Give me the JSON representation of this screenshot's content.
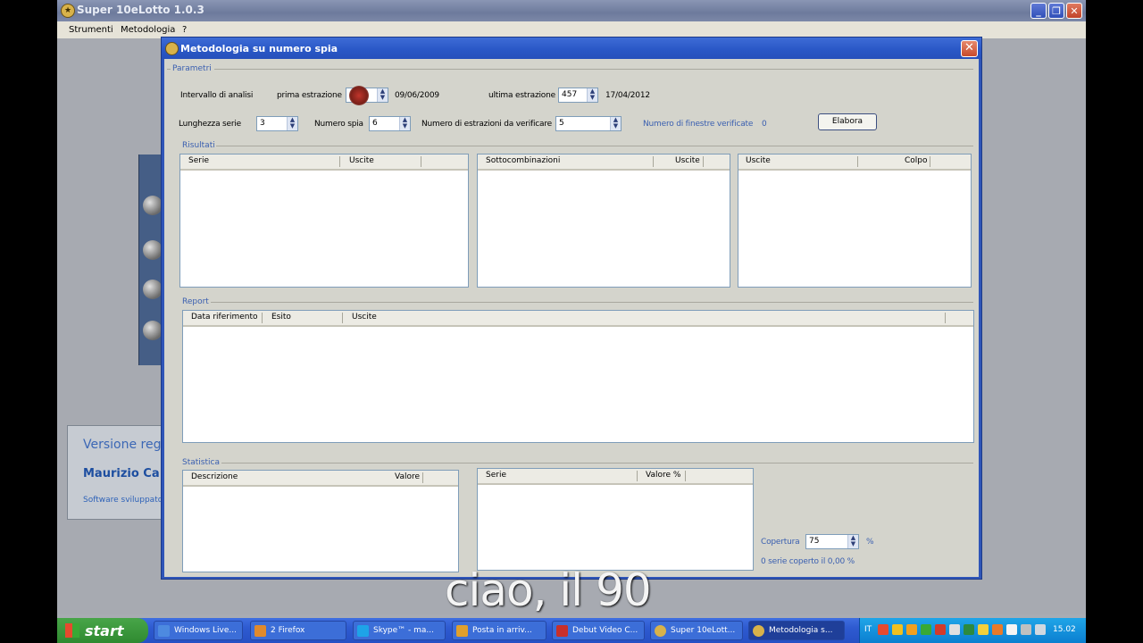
{
  "app": {
    "title": "Super 10eLotto 1.0.3",
    "menu": [
      "Strumenti",
      "Metodologia",
      "?"
    ],
    "license": {
      "version_text": "Versione regi",
      "name": "Maurizio Ca",
      "software_text": "Software sviluppato"
    }
  },
  "dialog": {
    "title": "Metodologia su numero spia",
    "close_label": "✕",
    "params": {
      "group_label": "Parametri",
      "interval_label": "Intervallo di analisi",
      "first_label": "prima estrazione",
      "first_value": "",
      "first_date": "09/06/2009",
      "last_label": "ultima estrazione",
      "last_value": "457",
      "last_date": "17/04/2012",
      "length_label": "Lunghezza serie",
      "length_value": "3",
      "spy_label": "Numero spia",
      "spy_value": "6",
      "draws_label": "Numero di estrazioni da verificare",
      "draws_value": "5",
      "windows_label": "Numero di finestre verificate",
      "windows_value": "0",
      "process_button": "Elabora"
    },
    "results": {
      "group_label": "Risultati",
      "list1": [
        "Serie",
        "Uscite"
      ],
      "list2": [
        "Sottocombinazioni",
        "Uscite"
      ],
      "list3": [
        "Uscite",
        "Colpo"
      ]
    },
    "report": {
      "group_label": "Report",
      "columns": [
        "Data riferimento",
        "Esito",
        "Uscite"
      ]
    },
    "stats": {
      "group_label": "Statistica",
      "list1": [
        "Descrizione",
        "Valore"
      ],
      "list2": [
        "Serie",
        "Valore %"
      ],
      "coverage_label": "Copertura",
      "coverage_value": "75",
      "coverage_unit": "%",
      "coverage_result": "0 serie coperto il 0,00 %"
    }
  },
  "caption": "ciao, il 90",
  "taskbar": {
    "start_label": "start",
    "items": [
      {
        "label": "Windows Live...",
        "color": "#4d8ae0"
      },
      {
        "label": "2 Firefox",
        "color": "#e08a2c"
      },
      {
        "label": "Skype™ - ma...",
        "color": "#1ea3e8"
      },
      {
        "label": "Posta in arriv...",
        "color": "#e0a02c"
      },
      {
        "label": "Debut Video C...",
        "color": "#c8302a"
      },
      {
        "label": "Super 10eLott...",
        "color": "#d8b24a"
      },
      {
        "label": "Metodologia s...",
        "color": "#d8b24a"
      }
    ],
    "language": "IT",
    "clock": "15.02"
  }
}
